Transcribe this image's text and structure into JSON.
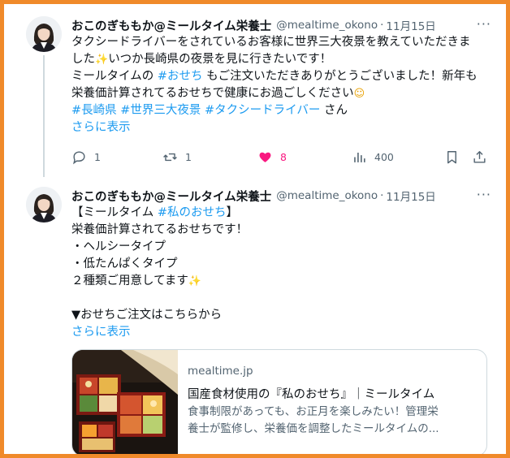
{
  "tweet1": {
    "author": {
      "name": "おこのぎももか@ミールタイム栄養士",
      "handle": "@mealtime_okono",
      "sep": "·",
      "date": "11月15日"
    },
    "more": "···",
    "lines": {
      "l1": "タクシードライバーをされているお客様に世界三大夜景を教えていただきま",
      "l2a": "した",
      "l2_emoji": "✨",
      "l2b": "いつか長崎県の夜景を見に行きたいです！",
      "l3a": "ミールタイムの ",
      "l3_tag": "#おせち",
      "l3b": " もご注文いただきありがとうございました！新年も",
      "l4a": "栄養価計算されてるおせちで健康にお過ごしください",
      "l4_emoji": "☺",
      "tag1": "#長崎県",
      "tag2": "#世界三大夜景",
      "tag3": "#タクシードライバー",
      "l5_suffix": " さん"
    },
    "show_more": "さらに表示",
    "actions": {
      "replies": "1",
      "retweets": "1",
      "likes": "8",
      "views": "400"
    }
  },
  "tweet2": {
    "author": {
      "name": "おこのぎももか@ミールタイム栄養士",
      "handle": "@mealtime_okono",
      "sep": "·",
      "date": "11月15日"
    },
    "more": "···",
    "lines": {
      "l1a": "【ミールタイム ",
      "l1_tag": "#私のおせち",
      "l1b": "】",
      "l2": "栄養価計算されてるおせちです！",
      "l3": "・ヘルシータイプ",
      "l4": "・低たんぱくタイプ",
      "l5": "２種類ご用意してます",
      "l5_emoji": "✨",
      "l6": "▼おせちご注文はこちらから"
    },
    "show_more": "さらに表示",
    "card": {
      "domain": "mealtime.jp",
      "title": "国産食材使用の『私のおせち』｜ミールタイム",
      "desc1": "食事制限があっても、お正月を楽しみたい！管理栄",
      "desc2": "養士が監修し、栄養価を調整したミールタイムの..."
    }
  },
  "colors": {
    "border": "#f08a2a",
    "link": "#1d9bf0",
    "like": "#f91880",
    "muted": "#536471"
  }
}
